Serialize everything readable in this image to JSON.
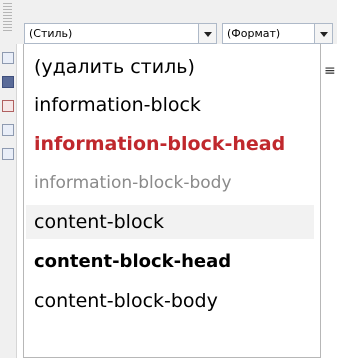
{
  "toolbar": {
    "style_combo_value": "(Стиль)",
    "format_combo_value": "(Формат)"
  },
  "dropdown": {
    "items": [
      {
        "label": "(удалить стиль)",
        "color": "#000000",
        "weight": "normal"
      },
      {
        "label": "information-block",
        "color": "#000000",
        "weight": "normal"
      },
      {
        "label": "information-block-head",
        "color": "#c0282d",
        "weight": "bold"
      },
      {
        "label": "information-block-body",
        "color": "#8a8a8a",
        "weight": "normal"
      },
      {
        "label": "content-block",
        "color": "#000000",
        "weight": "normal",
        "highlighted": true
      },
      {
        "label": "content-block-head",
        "color": "#000000",
        "weight": "bold"
      },
      {
        "label": "content-block-body",
        "color": "#000000",
        "weight": "normal"
      }
    ]
  },
  "icons": {
    "dropdown_arrow": "chevron-down-icon",
    "side_glyph": "align-icon"
  }
}
